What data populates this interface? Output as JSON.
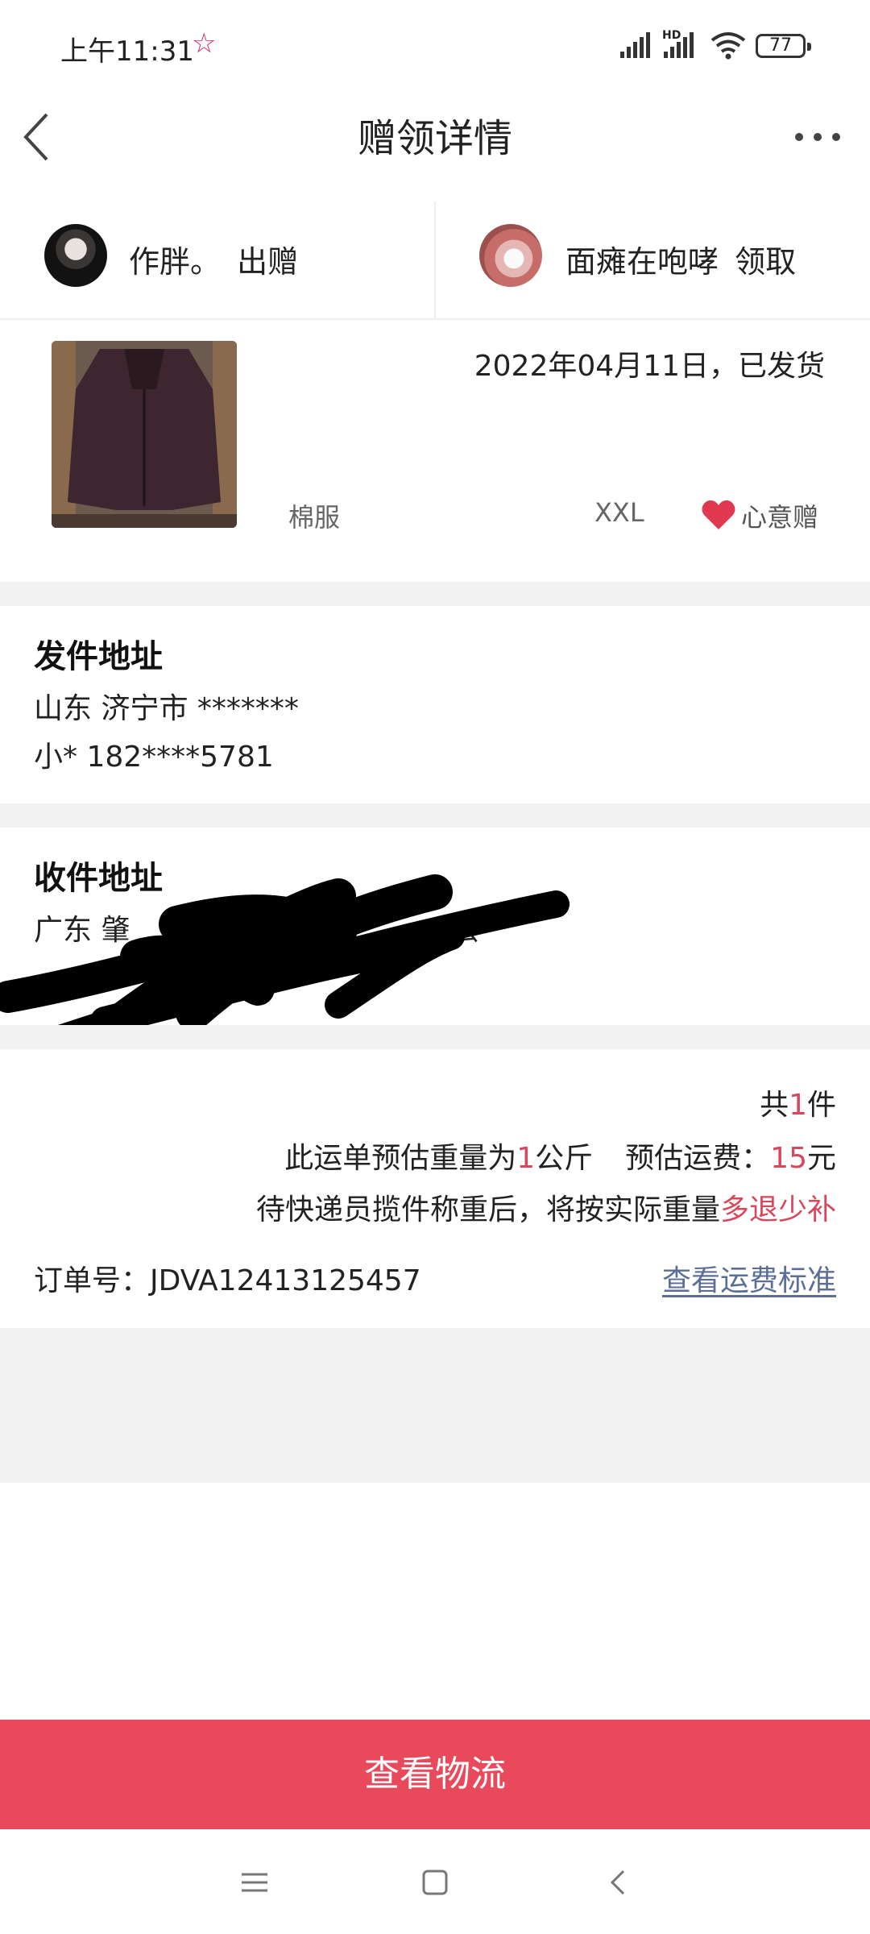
{
  "status_bar": {
    "time": "上午11:31",
    "network_badge": "HD",
    "battery": "77"
  },
  "nav": {
    "title": "赠领详情",
    "back_icon": "chevron-left-icon",
    "more_icon": "more-dots-icon"
  },
  "people": {
    "giver": {
      "name": "作胖。",
      "action": "出赠"
    },
    "receiver": {
      "name": "面瘫在咆哮",
      "action": "领取"
    }
  },
  "item": {
    "date_status": "2022年04月11日，已发货",
    "name": "棉服",
    "size": "XXL",
    "tag": "心意赠"
  },
  "sender_address": {
    "title": "发件地址",
    "line1": "山东 济宁市 *******",
    "line2": "小* 182****5781"
  },
  "receiver_address": {
    "title": "收件地址",
    "line1_start": "广东 肇",
    "line1_end": "会"
  },
  "shipping": {
    "count_prefix": "共",
    "count": "1",
    "count_suffix": "件",
    "weight_prefix": "此运单预估重量为",
    "weight": "1",
    "weight_suffix": "公斤",
    "fee_prefix": "预估运费：",
    "fee": "15",
    "fee_suffix": "元",
    "note_prefix": "待快递员揽件称重后，将按实际重量",
    "note_highlight": "多退少补",
    "order_label": "订单号：",
    "order_number": "JDVA12413125457",
    "fee_link": "查看运费标准"
  },
  "bottom_button": "查看物流",
  "colors": {
    "accent": "#e84a5c",
    "price_red": "#d8475c",
    "link": "#5a6e98",
    "gap_gray": "#f2f2f2"
  }
}
